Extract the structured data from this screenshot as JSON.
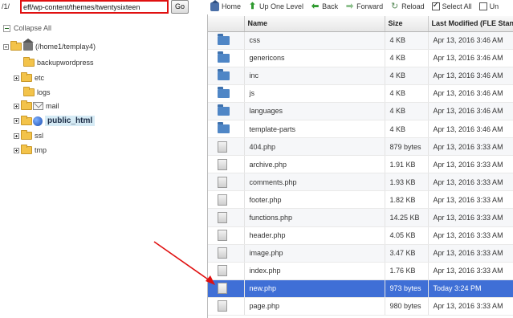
{
  "pathbar": {
    "prefix": "/1/",
    "path_value": "eff/wp-content/themes/twentysixteen",
    "go_label": "Go"
  },
  "toolbar": {
    "home": "Home",
    "up": "Up One Level",
    "back": "Back",
    "forward": "Forward",
    "reload": "Reload",
    "select_all": "Select All",
    "unselect": "Un",
    "select_all_checked": true
  },
  "tree": {
    "collapse_all": "Collapse All",
    "root_label": "(/home1/templay4)",
    "items": [
      {
        "label": "backupwordpress"
      },
      {
        "label": "etc"
      },
      {
        "label": "logs"
      },
      {
        "label": "mail"
      },
      {
        "label": "public_html"
      },
      {
        "label": "ssl"
      },
      {
        "label": "tmp"
      }
    ]
  },
  "table": {
    "headers": {
      "name": "Name",
      "size": "Size",
      "modified": "Last Modified (FLE Standa"
    },
    "rows": [
      {
        "type": "folder",
        "name": "css",
        "size": "4 KB",
        "modified": "Apr 13, 2016 3:46 AM"
      },
      {
        "type": "folder",
        "name": "genericons",
        "size": "4 KB",
        "modified": "Apr 13, 2016 3:46 AM"
      },
      {
        "type": "folder",
        "name": "inc",
        "size": "4 KB",
        "modified": "Apr 13, 2016 3:46 AM"
      },
      {
        "type": "folder",
        "name": "js",
        "size": "4 KB",
        "modified": "Apr 13, 2016 3:46 AM"
      },
      {
        "type": "folder",
        "name": "languages",
        "size": "4 KB",
        "modified": "Apr 13, 2016 3:46 AM"
      },
      {
        "type": "folder",
        "name": "template-parts",
        "size": "4 KB",
        "modified": "Apr 13, 2016 3:46 AM"
      },
      {
        "type": "file",
        "name": "404.php",
        "size": "879 bytes",
        "modified": "Apr 13, 2016 3:33 AM"
      },
      {
        "type": "file",
        "name": "archive.php",
        "size": "1.91 KB",
        "modified": "Apr 13, 2016 3:33 AM"
      },
      {
        "type": "file",
        "name": "comments.php",
        "size": "1.93 KB",
        "modified": "Apr 13, 2016 3:33 AM"
      },
      {
        "type": "file",
        "name": "footer.php",
        "size": "1.82 KB",
        "modified": "Apr 13, 2016 3:33 AM"
      },
      {
        "type": "file",
        "name": "functions.php",
        "size": "14.25 KB",
        "modified": "Apr 13, 2016 3:33 AM"
      },
      {
        "type": "file",
        "name": "header.php",
        "size": "4.05 KB",
        "modified": "Apr 13, 2016 3:33 AM"
      },
      {
        "type": "file",
        "name": "image.php",
        "size": "3.47 KB",
        "modified": "Apr 13, 2016 3:33 AM"
      },
      {
        "type": "file",
        "name": "index.php",
        "size": "1.76 KB",
        "modified": "Apr 13, 2016 3:33 AM"
      },
      {
        "type": "file",
        "name": "new.php",
        "size": "973 bytes",
        "modified": "Today 3:24 PM",
        "selected": true
      },
      {
        "type": "file",
        "name": "page.php",
        "size": "980 bytes",
        "modified": "Apr 13, 2016 3:33 AM"
      }
    ]
  },
  "colors": {
    "selected_row": "#3f6fd6",
    "path_highlight": "#e01010",
    "annotation_arrow": "#e01010"
  }
}
